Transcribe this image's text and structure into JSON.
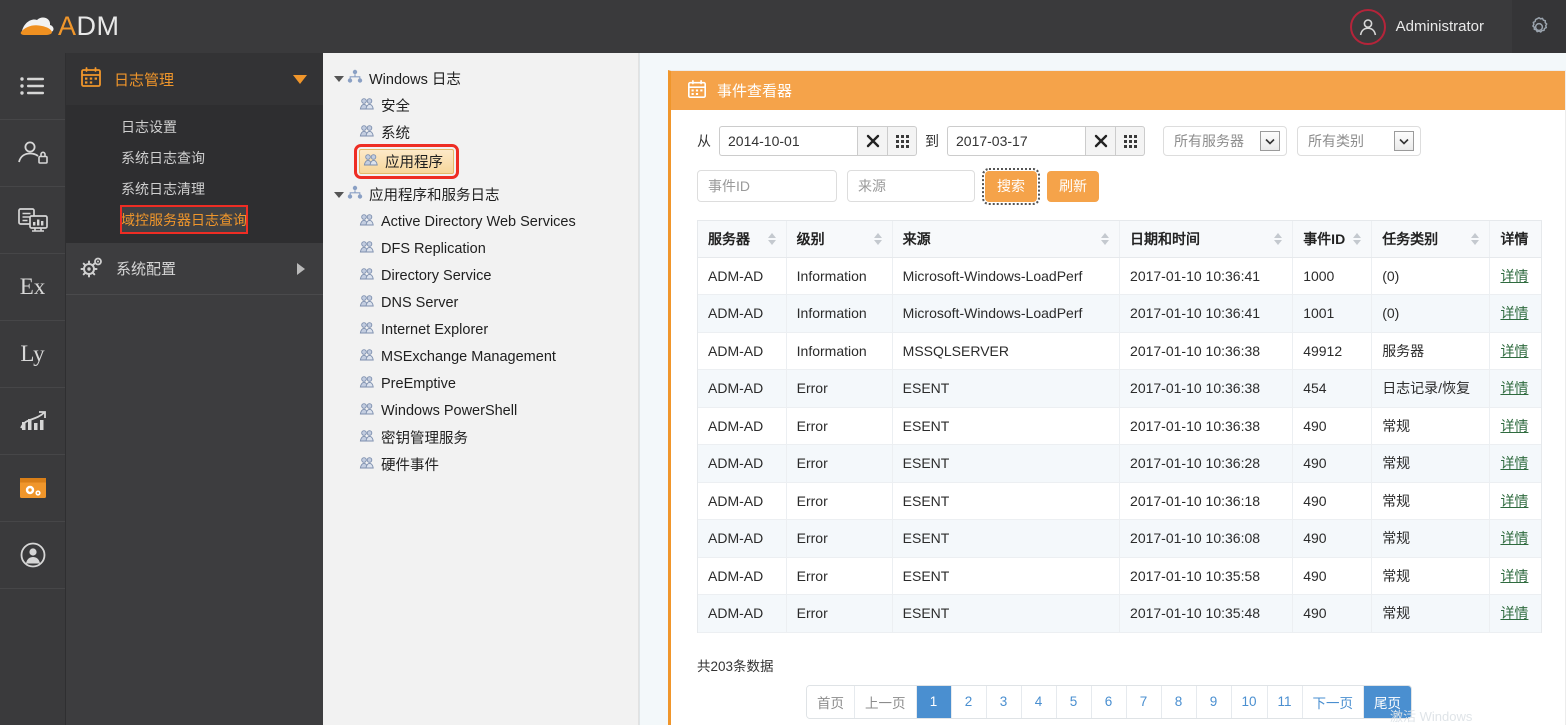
{
  "topbar": {
    "logo_text_a": "A",
    "logo_text_rest": "DM",
    "logo_icon": "cloud-icon",
    "user_name": "Administrator",
    "avatar_icon": "user-avatar-icon",
    "settings_icon": "gear-icon"
  },
  "rail": {
    "items": [
      {
        "name": "menu-list-icon",
        "glyph": "list"
      },
      {
        "name": "user-lock-icon",
        "glyph": "userlock"
      },
      {
        "name": "monitor-report-icon",
        "glyph": "monitor"
      },
      {
        "name": "ex-icon",
        "glyph": "letters",
        "text": "Ex"
      },
      {
        "name": "ly-icon",
        "glyph": "letters",
        "text": "Ly"
      },
      {
        "name": "chart-growth-icon",
        "glyph": "chart"
      },
      {
        "name": "system-config-icon",
        "glyph": "geararea"
      },
      {
        "name": "user-circle-icon",
        "glyph": "usercircle"
      }
    ]
  },
  "nav": {
    "group_label": "日志管理",
    "group_icon": "calendar-icon",
    "caret_icon": "chevron-down-icon",
    "items": [
      {
        "label": "日志设置",
        "active": false
      },
      {
        "label": "系统日志查询",
        "active": false
      },
      {
        "label": "系统日志清理",
        "active": false
      },
      {
        "label": "域控服务器日志查询",
        "active": true
      }
    ],
    "group2_label": "系统配置",
    "group2_icon": "gears-icon",
    "group2_arrow": "chevron-right-icon"
  },
  "tree": {
    "nodes": [
      {
        "label": "Windows 日志",
        "icon": "network-node-icon",
        "expanded": true,
        "children": [
          {
            "label": "安全",
            "icon": "log-icon",
            "selected": false
          },
          {
            "label": "系统",
            "icon": "log-icon",
            "selected": false
          },
          {
            "label": "应用程序",
            "icon": "log-icon",
            "selected": true
          }
        ]
      },
      {
        "label": "应用程序和服务日志",
        "icon": "network-node-icon",
        "expanded": true,
        "children": [
          {
            "label": "Active Directory Web Services",
            "icon": "log-icon",
            "selected": false
          },
          {
            "label": "DFS Replication",
            "icon": "log-icon",
            "selected": false
          },
          {
            "label": "Directory Service",
            "icon": "log-icon",
            "selected": false
          },
          {
            "label": "DNS Server",
            "icon": "log-icon",
            "selected": false
          },
          {
            "label": "Internet Explorer",
            "icon": "log-icon",
            "selected": false
          },
          {
            "label": "MSExchange Management",
            "icon": "log-icon",
            "selected": false
          },
          {
            "label": "PreEmptive",
            "icon": "log-icon",
            "selected": false
          },
          {
            "label": "Windows PowerShell",
            "icon": "log-icon",
            "selected": false
          },
          {
            "label": "密钥管理服务",
            "icon": "log-icon",
            "selected": false
          },
          {
            "label": "硬件事件",
            "icon": "log-icon",
            "selected": false
          }
        ]
      }
    ]
  },
  "panel": {
    "title": "事件查看器",
    "title_icon": "calendar-icon",
    "toolbar": {
      "from_label": "从",
      "from_value": "2014-10-01",
      "to_label": "到",
      "to_value": "2017-03-17",
      "clear_icon": "clear-x-icon",
      "calendar_icon": "calendar-grid-icon",
      "server_select": "所有服务器",
      "category_select": "所有类别",
      "eventid_placeholder": "事件ID",
      "eventid_value": "",
      "source_placeholder": "来源",
      "source_value": "",
      "search_label": "搜索",
      "refresh_label": "刷新",
      "accent_color": "#f5a34a"
    },
    "table": {
      "columns": [
        {
          "label": "服务器",
          "sortable": true
        },
        {
          "label": "级别",
          "sortable": true
        },
        {
          "label": "来源",
          "sortable": true
        },
        {
          "label": "日期和时间",
          "sortable": true
        },
        {
          "label": "事件ID",
          "sortable": true
        },
        {
          "label": "任务类别",
          "sortable": true
        },
        {
          "label": "详情",
          "sortable": false
        }
      ],
      "detail_label": "详情",
      "rows": [
        [
          "ADM-AD",
          "Information",
          "Microsoft-Windows-LoadPerf",
          "2017-01-10 10:36:41",
          "1000",
          "(0)"
        ],
        [
          "ADM-AD",
          "Information",
          "Microsoft-Windows-LoadPerf",
          "2017-01-10 10:36:41",
          "1001",
          "(0)"
        ],
        [
          "ADM-AD",
          "Information",
          "MSSQLSERVER",
          "2017-01-10 10:36:38",
          "49912",
          "服务器"
        ],
        [
          "ADM-AD",
          "Error",
          "ESENT",
          "2017-01-10 10:36:38",
          "454",
          "日志记录/恢复"
        ],
        [
          "ADM-AD",
          "Error",
          "ESENT",
          "2017-01-10 10:36:38",
          "490",
          "常规"
        ],
        [
          "ADM-AD",
          "Error",
          "ESENT",
          "2017-01-10 10:36:28",
          "490",
          "常规"
        ],
        [
          "ADM-AD",
          "Error",
          "ESENT",
          "2017-01-10 10:36:18",
          "490",
          "常规"
        ],
        [
          "ADM-AD",
          "Error",
          "ESENT",
          "2017-01-10 10:36:08",
          "490",
          "常规"
        ],
        [
          "ADM-AD",
          "Error",
          "ESENT",
          "2017-01-10 10:35:58",
          "490",
          "常规"
        ],
        [
          "ADM-AD",
          "Error",
          "ESENT",
          "2017-01-10 10:35:48",
          "490",
          "常规"
        ]
      ]
    },
    "pagination": {
      "total_text": "共203条数据",
      "first": "首页",
      "prev": "上一页",
      "pages": [
        "1",
        "2",
        "3",
        "4",
        "5",
        "6",
        "7",
        "8",
        "9",
        "10",
        "11"
      ],
      "current": "1",
      "next": "下一页",
      "last": "尾页",
      "active_color": "#4a8fd0"
    }
  },
  "watermark": "激活 Windows"
}
